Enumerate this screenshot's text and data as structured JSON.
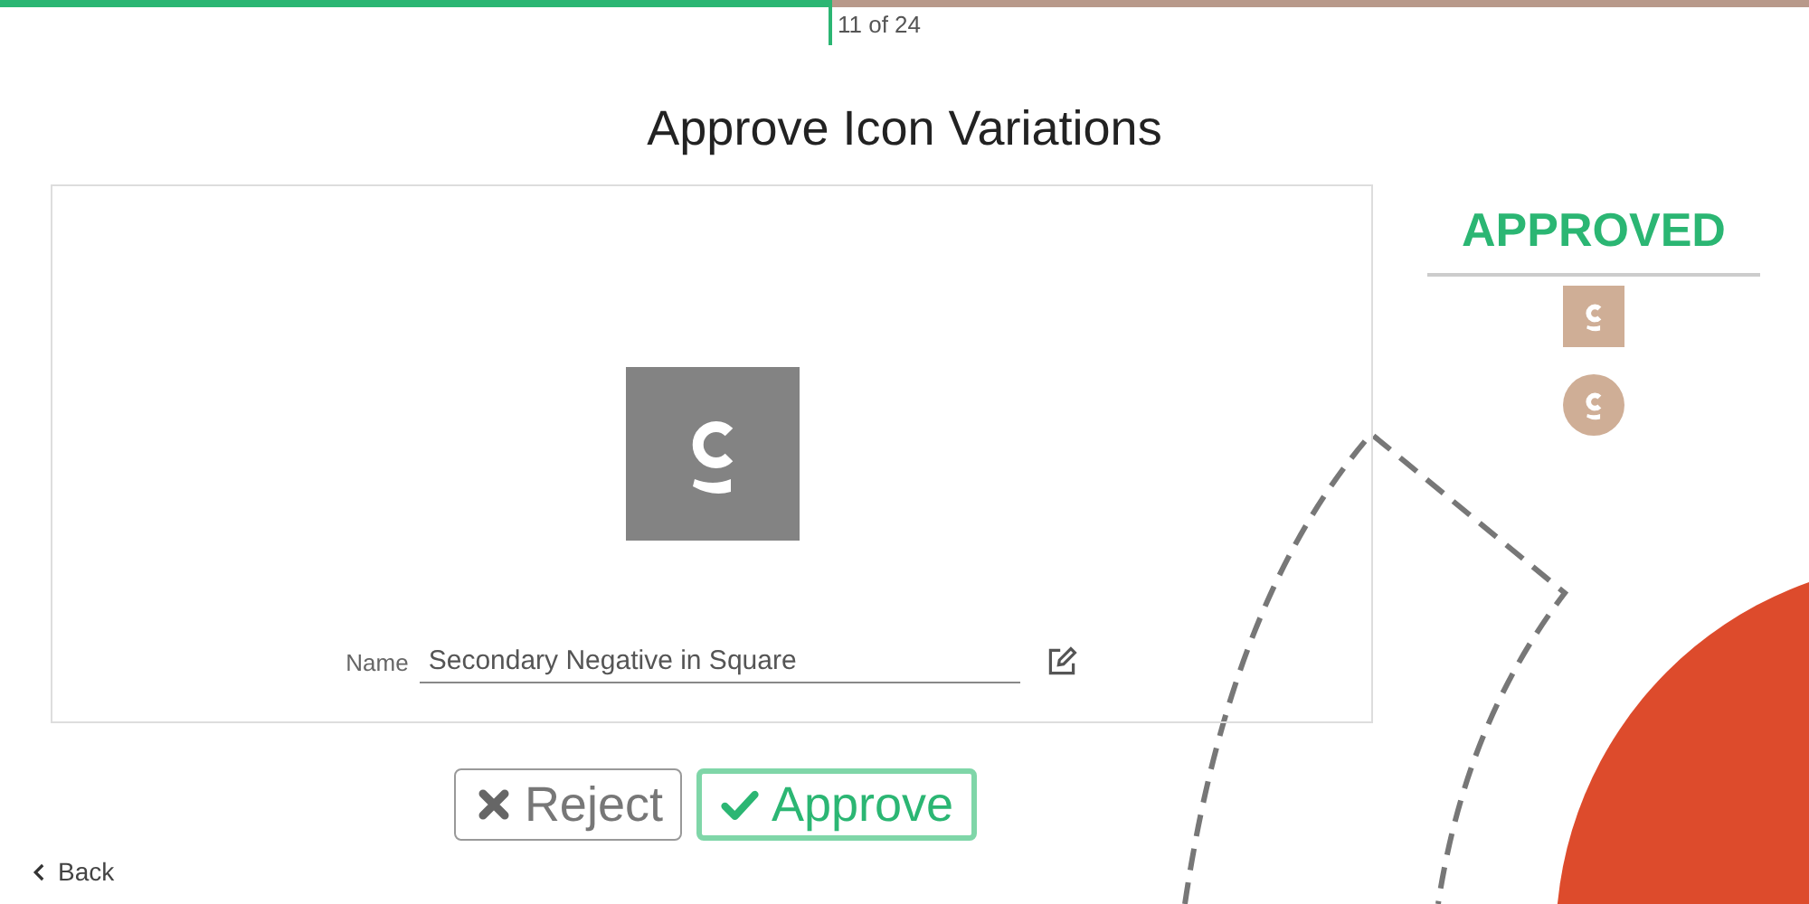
{
  "progress": {
    "level": 0.458,
    "label": "11 of 24"
  },
  "title": "Approve Icon Variations",
  "preview": {
    "icon": {
      "kind": "square"
    },
    "name_label": "Name",
    "name_value": "Secondary Negative in Square"
  },
  "buttons": [
    {
      "kind": "reject",
      "label": "Reject"
    },
    {
      "kind": "approve",
      "label": "Approve"
    }
  ],
  "approved": {
    "heading": "APPROVED",
    "items": [
      {
        "kind": "square"
      },
      {
        "kind": "circle"
      }
    ]
  },
  "back": "Back"
}
